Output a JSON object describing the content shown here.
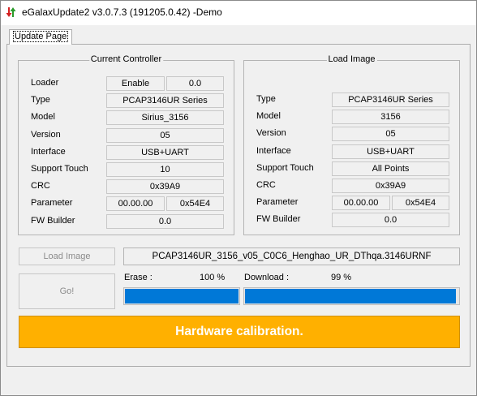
{
  "window": {
    "title": "eGalaxUpdate2 v3.0.7.3 (191205.0.42) -Demo",
    "tab_label": "Update Page"
  },
  "current_controller": {
    "title": "Current Controller",
    "rows": [
      {
        "label": "Loader",
        "values": [
          "Enable",
          "0.0"
        ]
      },
      {
        "label": "Type",
        "values": [
          "PCAP3146UR Series"
        ]
      },
      {
        "label": "Model",
        "values": [
          "Sirius_3156"
        ]
      },
      {
        "label": "Version",
        "values": [
          "05"
        ]
      },
      {
        "label": "Interface",
        "values": [
          "USB+UART"
        ]
      },
      {
        "label": "Support Touch",
        "values": [
          "10"
        ]
      },
      {
        "label": "CRC",
        "values": [
          "0x39A9"
        ]
      },
      {
        "label": "Parameter",
        "values": [
          "00.00.00",
          "0x54E4"
        ]
      },
      {
        "label": "FW Builder",
        "values": [
          "0.0"
        ]
      }
    ]
  },
  "load_image": {
    "title": "Load Image",
    "rows": [
      {
        "label": "Type",
        "values": [
          "PCAP3146UR Series"
        ]
      },
      {
        "label": "Model",
        "values": [
          "3156"
        ]
      },
      {
        "label": "Version",
        "values": [
          "05"
        ]
      },
      {
        "label": "Interface",
        "values": [
          "USB+UART"
        ]
      },
      {
        "label": "Support Touch",
        "values": [
          "All Points"
        ]
      },
      {
        "label": "CRC",
        "values": [
          "0x39A9"
        ]
      },
      {
        "label": "Parameter",
        "values": [
          "00.00.00",
          "0x54E4"
        ]
      },
      {
        "label": "FW Builder",
        "values": [
          "0.0"
        ]
      }
    ]
  },
  "actions": {
    "load_image_button": "Load Image",
    "go_button": "Go!",
    "filename": "PCAP3146UR_3156_v05_C0C6_Henghao_UR_DThqa.3146URNF"
  },
  "progress": {
    "erase_label": "Erase :",
    "erase_percent": "100 %",
    "erase_fraction": 1.0,
    "download_label": "Download :",
    "download_percent": "99 %",
    "download_fraction": 0.99
  },
  "status": {
    "message": "Hardware calibration.",
    "color": "#ffb000"
  }
}
